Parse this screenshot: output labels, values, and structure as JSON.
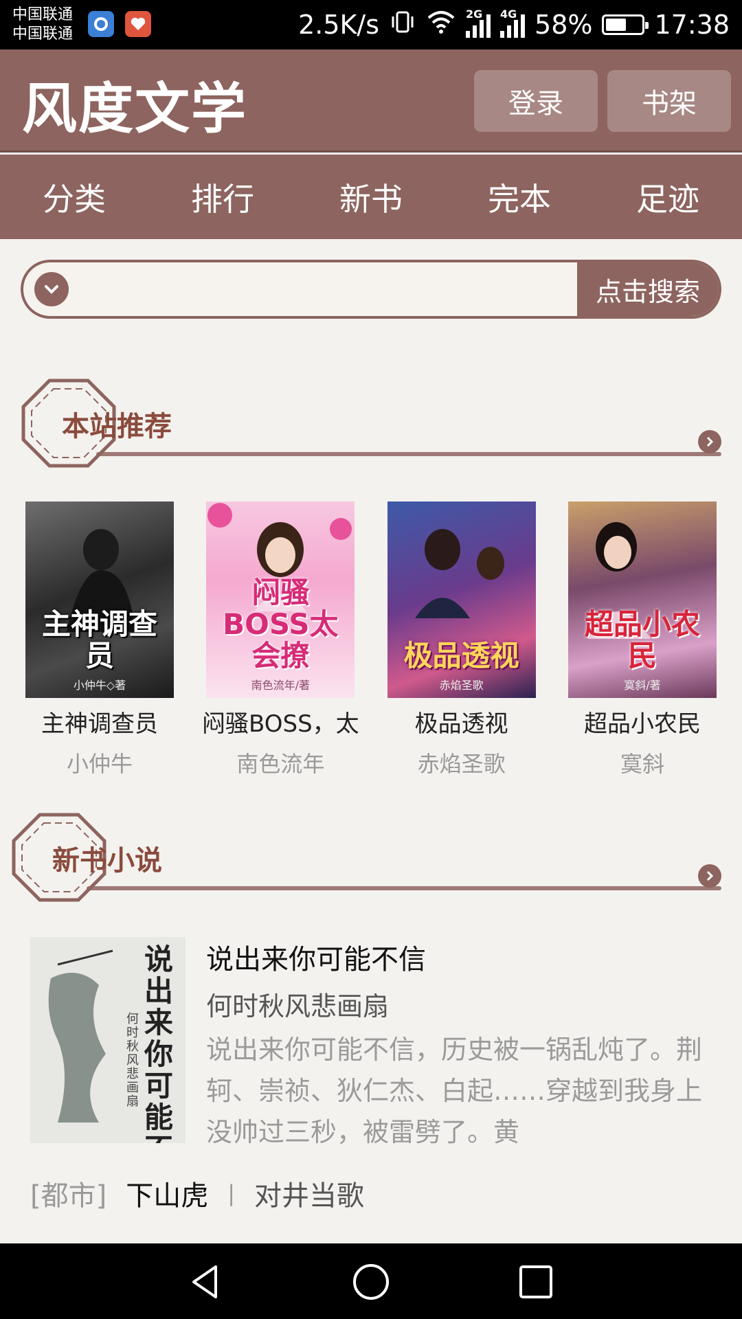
{
  "status_bar": {
    "carrier1": "中国联通",
    "carrier2": "中国联通",
    "speed": "2.5K/s",
    "net2g": "2G",
    "net4g": "4G",
    "battery": "58%",
    "battery_level": 0.58,
    "time": "17:38"
  },
  "header": {
    "logo": "风度文学",
    "login": "登录",
    "bookshelf": "书架"
  },
  "nav": [
    {
      "label": "分类"
    },
    {
      "label": "排行"
    },
    {
      "label": "新书"
    },
    {
      "label": "完本"
    },
    {
      "label": "足迹"
    }
  ],
  "search": {
    "value": "",
    "button": "点击搜索"
  },
  "sections": {
    "recommend": {
      "title": "本站推荐"
    },
    "new_books": {
      "title": "新书小说"
    }
  },
  "recommend": [
    {
      "title": "主神调查员",
      "author": "小仲牛",
      "cover_text": "主神调查员",
      "cover_author": "小仲牛◇著"
    },
    {
      "title": "闷骚BOSS，太",
      "author": "南色流年",
      "cover_text": "闷骚BOSS太会撩",
      "cover_author": "南色流年/著"
    },
    {
      "title": "极品透视",
      "author": "赤焰圣歌",
      "cover_text": "极品透视",
      "cover_author": "赤焰圣歌"
    },
    {
      "title": "超品小农民",
      "author": "寞斜",
      "cover_text": "超品小农民",
      "cover_author": "寞斜/著"
    }
  ],
  "new_book": {
    "title": "说出来你可能不信",
    "author": "何时秋风悲画扇",
    "desc": "说出来你可能不信，历史被一锅乱炖了。荆轲、崇祯、狄仁杰、白起……穿越到我身上没帅过三秒，被雷劈了。黄",
    "cover_text": "说出来你可能不信",
    "cover_author": "何时秋风悲画扇"
  },
  "list": [
    {
      "category": "[都市]",
      "name": "下山虎",
      "separator": "|",
      "author": "对井当歌"
    }
  ]
}
